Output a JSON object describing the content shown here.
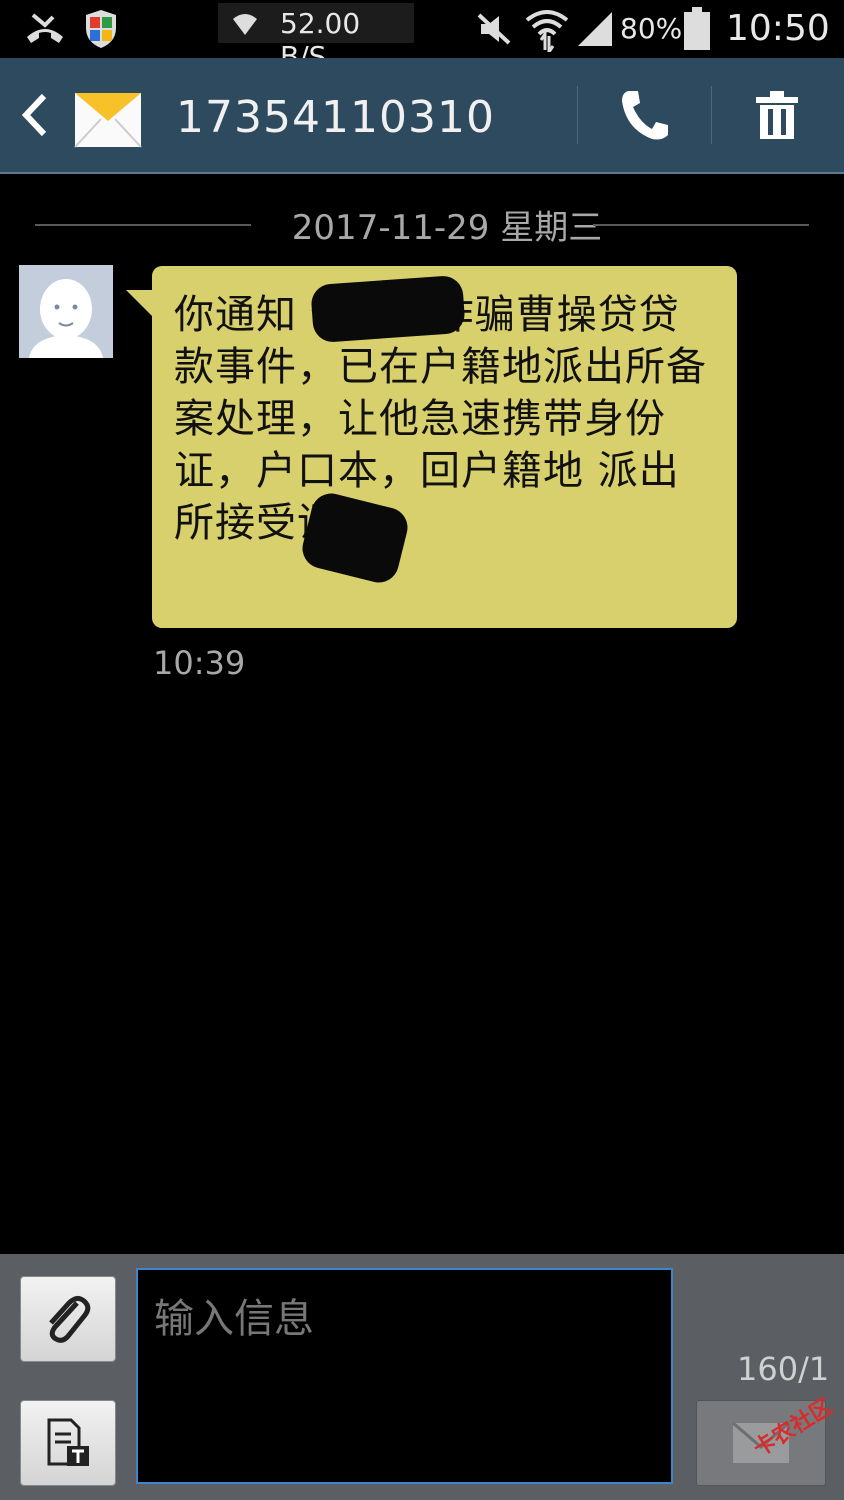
{
  "status_bar": {
    "net_speed": "52.00 B/S",
    "battery_percent": "80%",
    "time": "10:50",
    "icons": [
      "missed-call-icon",
      "shield-icon",
      "wifi-icon",
      "mute-icon",
      "wifi-signal-icon",
      "cell-signal-icon",
      "battery-icon"
    ]
  },
  "header": {
    "contact": "17354110310",
    "icons": [
      "back-icon",
      "envelope-icon",
      "phone-icon",
      "trash-icon"
    ]
  },
  "conversation": {
    "date": "2017-11-29 星期三",
    "messages": [
      {
        "text": "你通知         他涉嫌诈骗曹操贷贷款事件，已在户籍地派出所备案处理，让他急速携带身份证，户口本，回户籍地    派出所接受调查。",
        "time": "10:39"
      }
    ]
  },
  "composer": {
    "placeholder": "输入信息",
    "counter": "160/1",
    "watermark": "卡农社区"
  },
  "colors": {
    "actionbar": "#2e4a5e",
    "bubble": "#d8d06c",
    "input_border": "#3d87c8"
  }
}
